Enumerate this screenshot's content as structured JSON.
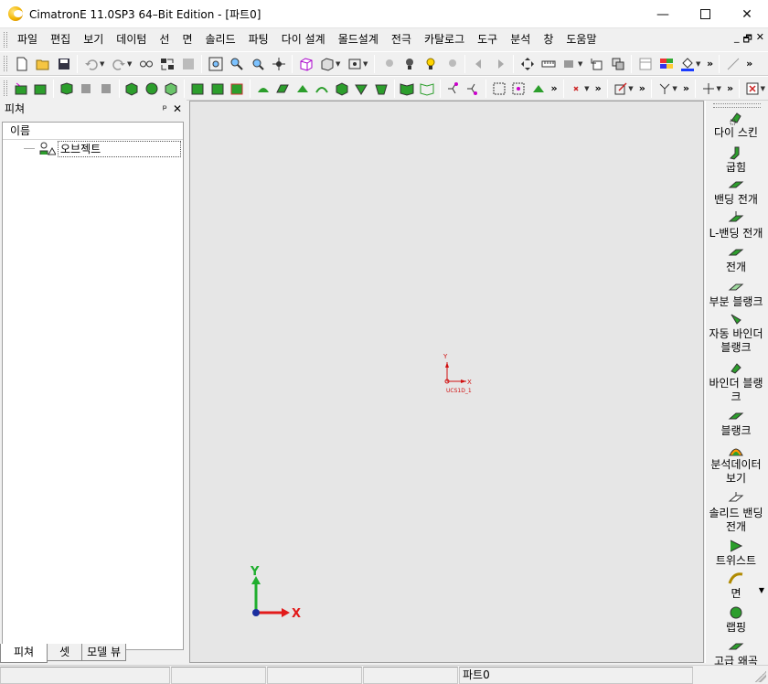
{
  "window": {
    "title": "CimatronE 11.0SP3 64–Bit Edition - [파트0]",
    "minimize": "—",
    "maximize": "☐",
    "close": "✕"
  },
  "menu": [
    "파일",
    "편집",
    "보기",
    "데이텀",
    "선",
    "면",
    "솔리드",
    "파팅",
    "다이 설계",
    "몰드설계",
    "전극",
    "카탈로그",
    "도구",
    "분석",
    "창",
    "도움말"
  ],
  "mdi": {
    "minimize": "_",
    "restore": "🗗",
    "close": "✕"
  },
  "feature_panel": {
    "title": "피쳐",
    "pin": "ᵖ",
    "close": "✕",
    "column_header": "이름",
    "tree": [
      {
        "label": "오브젝트",
        "icon": "objects-icon"
      }
    ],
    "tabs": [
      "피쳐",
      "셋",
      "모델 뷰"
    ]
  },
  "viewport": {
    "ucs_label": "UCS1D_1",
    "ucs_axis_x": "X",
    "ucs_axis_y": "Y",
    "triad_x": "X",
    "triad_y": "Y",
    "colors": {
      "x_axis": "#e21b1b",
      "y_axis": "#1fae2e",
      "ucs": "#d01010",
      "background": "#e6e6e6"
    }
  },
  "right_toolbar": [
    "다이 스킨",
    "굽힘",
    "밴딩 전개",
    "L-밴딩 전개",
    "전개",
    "부분 블랭크",
    "자동 바인더\n블랭크",
    "바인더 블랭\n크",
    "블랭크",
    "분석데이터\n보기",
    "솔리드 밴딩\n전개",
    "트위스트",
    "면",
    "랩핑",
    "고급 왜곡"
  ],
  "status": {
    "part": "파트0"
  }
}
